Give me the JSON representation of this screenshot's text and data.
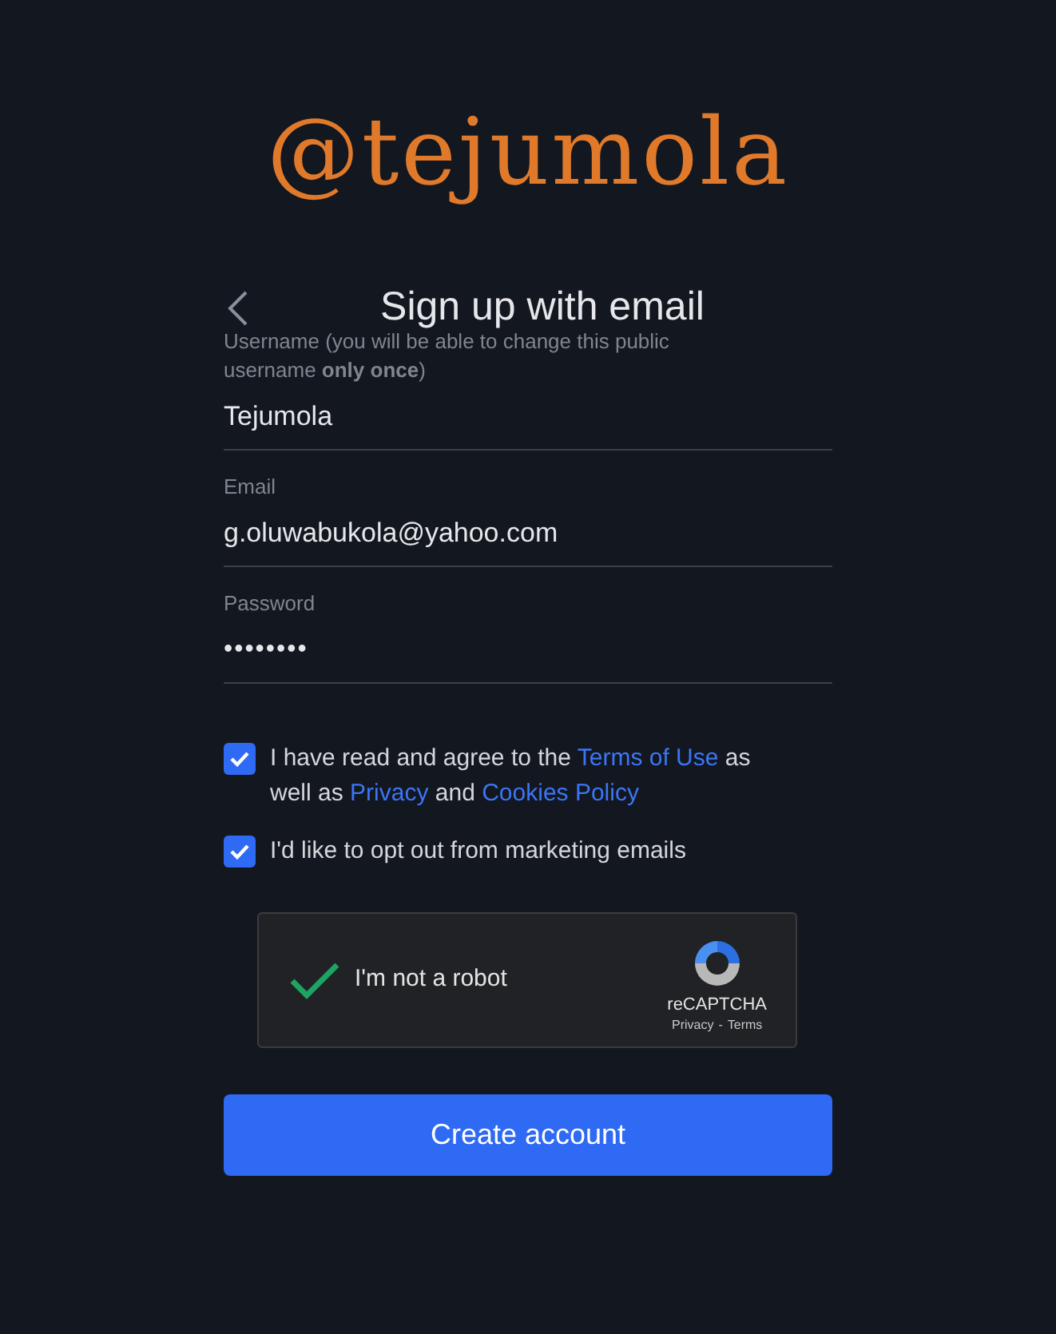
{
  "overlay_text": "@tejumola",
  "header": {
    "title": "Sign up with email"
  },
  "fields": [
    {
      "kind": "text",
      "label": "Username (you will be able to change this public username **only once**)",
      "value": "Tejumola"
    },
    {
      "kind": "text",
      "label": "Email",
      "value": "g.oluwabukola@yahoo.com"
    },
    {
      "kind": "password",
      "label": "Password",
      "value": "••••••••"
    }
  ],
  "checkboxes": [
    {
      "checked": true,
      "segments": [
        {
          "text": "I have read and agree to the ",
          "link": false
        },
        {
          "text": "Terms of Use",
          "link": true
        },
        {
          "text": " as well as ",
          "link": false
        },
        {
          "text": "Privacy",
          "link": true
        },
        {
          "text": " and ",
          "link": false
        },
        {
          "text": "Cookies Policy",
          "link": true
        }
      ]
    },
    {
      "checked": true,
      "segments": [
        {
          "text": "I'd like to opt out from marketing emails",
          "link": false
        }
      ]
    }
  ],
  "recaptcha": {
    "checked": true,
    "label": "I'm not a robot",
    "brand": "reCAPTCHA",
    "privacy": "Privacy",
    "separator": "-",
    "terms": "Terms"
  },
  "submit_button": "Create account"
}
